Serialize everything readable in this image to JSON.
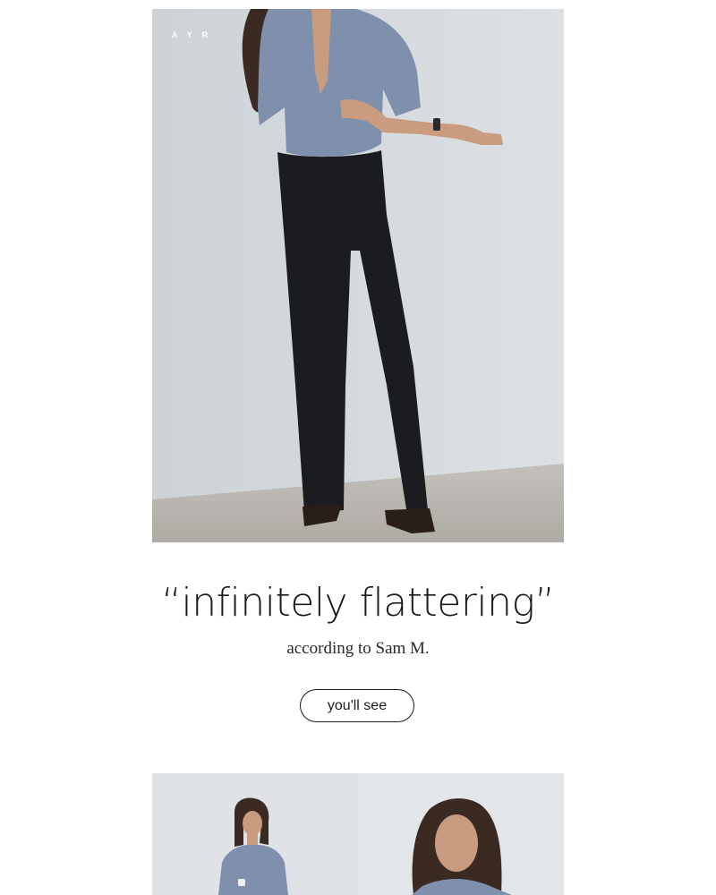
{
  "brand": {
    "logo_text": "AYR"
  },
  "hero": {
    "image_name": "model-in-blue-shirt-and-black-wide-leg-pants",
    "colors": {
      "wall": "#d6dbdf",
      "floor": "#b9b6b1",
      "shirt": "#7f90ad",
      "pants": "#1b1c20",
      "skin": "#c99b7f",
      "hair": "#3a2a22"
    }
  },
  "review": {
    "quote": "“infinitely flattering”",
    "attribution": "according to Sam M."
  },
  "cta": {
    "label": "you'll see"
  },
  "gallery": {
    "left_image_name": "model-seated-in-blue-shirt",
    "right_image_name": "model-portrait-in-blue-shirt"
  }
}
